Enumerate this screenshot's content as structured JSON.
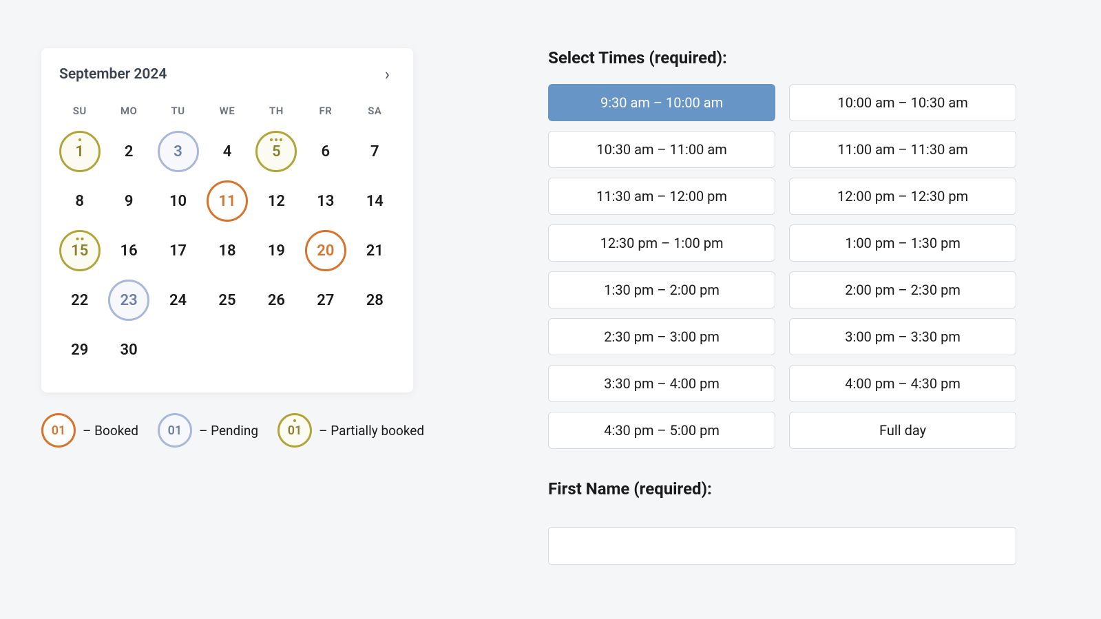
{
  "calendar": {
    "title": "September 2024",
    "next_label": "›",
    "dow": [
      "SU",
      "MO",
      "TU",
      "WE",
      "TH",
      "FR",
      "SA"
    ],
    "days": [
      {
        "n": "1",
        "status": "partial",
        "dots": 1
      },
      {
        "n": "2"
      },
      {
        "n": "3",
        "status": "pending"
      },
      {
        "n": "4"
      },
      {
        "n": "5",
        "status": "partial",
        "dots": 3
      },
      {
        "n": "6"
      },
      {
        "n": "7"
      },
      {
        "n": "8"
      },
      {
        "n": "9"
      },
      {
        "n": "10"
      },
      {
        "n": "11",
        "status": "booked"
      },
      {
        "n": "12"
      },
      {
        "n": "13"
      },
      {
        "n": "14"
      },
      {
        "n": "15",
        "status": "partial",
        "dots": 2
      },
      {
        "n": "16"
      },
      {
        "n": "17"
      },
      {
        "n": "18"
      },
      {
        "n": "19"
      },
      {
        "n": "20",
        "status": "booked"
      },
      {
        "n": "21"
      },
      {
        "n": "22"
      },
      {
        "n": "23",
        "status": "pending"
      },
      {
        "n": "24"
      },
      {
        "n": "25"
      },
      {
        "n": "26"
      },
      {
        "n": "27"
      },
      {
        "n": "28"
      },
      {
        "n": "29"
      },
      {
        "n": "30"
      }
    ]
  },
  "legend": {
    "booked": {
      "num": "01",
      "label": "– Booked"
    },
    "pending": {
      "num": "01",
      "label": "– Pending"
    },
    "partial": {
      "num": "01",
      "label": "– Partially booked",
      "dots": 1
    }
  },
  "times": {
    "title": "Select Times (required):",
    "slots": [
      {
        "label": "9:30 am – 10:00 am",
        "selected": true
      },
      {
        "label": "10:00 am – 10:30 am"
      },
      {
        "label": "10:30 am – 11:00 am"
      },
      {
        "label": "11:00 am – 11:30 am"
      },
      {
        "label": "11:30 am – 12:00 pm"
      },
      {
        "label": "12:00 pm – 12:30 pm"
      },
      {
        "label": "12:30 pm – 1:00 pm"
      },
      {
        "label": "1:00 pm – 1:30 pm"
      },
      {
        "label": "1:30 pm – 2:00 pm"
      },
      {
        "label": "2:00 pm – 2:30 pm"
      },
      {
        "label": "2:30 pm – 3:00 pm"
      },
      {
        "label": "3:00 pm – 3:30 pm"
      },
      {
        "label": "3:30 pm – 4:00 pm"
      },
      {
        "label": "4:00 pm – 4:30 pm"
      },
      {
        "label": "4:30 pm – 5:00 pm"
      },
      {
        "label": "Full day"
      }
    ]
  },
  "first_name": {
    "title": "First Name (required):",
    "value": ""
  }
}
